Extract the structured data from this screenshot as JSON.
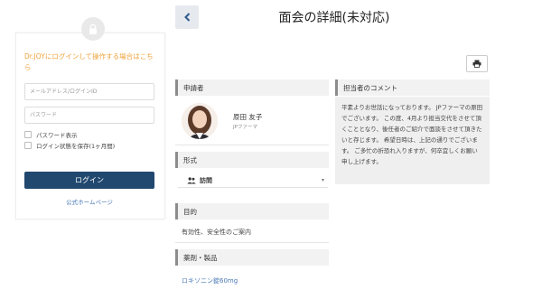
{
  "login": {
    "heading": "Dr.JOYにログインして操作する場合はこちら",
    "email_placeholder": "メールアドレス/ログインID",
    "password_placeholder": "パスワード",
    "show_password_label": "パスワード表示",
    "remember_label": "ログイン状態を保存(1ヶ月間)",
    "login_button_label": "ログイン",
    "homepage_link": "公式ホームページ"
  },
  "header": {
    "back_icon": "chevron-left-icon",
    "title": "面会の詳細(未対応)",
    "print_icon": "printer-icon"
  },
  "applicant": {
    "section_title": "申請者",
    "name": "原田 友子",
    "company": "JPファーマ"
  },
  "format": {
    "section_title": "形式",
    "selected_value": "訪問",
    "icon": "people-icon"
  },
  "purpose": {
    "section_title": "目的",
    "text": "有効性、安全性のご案内"
  },
  "products": {
    "section_title": "薬剤・製品",
    "item": "ロキソニン錠60mg"
  },
  "comment": {
    "section_title": "担当者のコメント",
    "text": "平素よりお世話になっております。 JPファーマの原田でございます。 この度、4月より担当交代をさせて頂くこととなり、後任者のご紹介で面談をさせて頂きたいと存じます。 希望日時は、上記の通りでございます。 ご多忙の折恐れ入りますが、何卒宜しくお願い申し上げます。"
  },
  "colors": {
    "brand_navy": "#21486f",
    "heading_orange": "#f0a33c",
    "link_blue": "#4a78b5"
  }
}
